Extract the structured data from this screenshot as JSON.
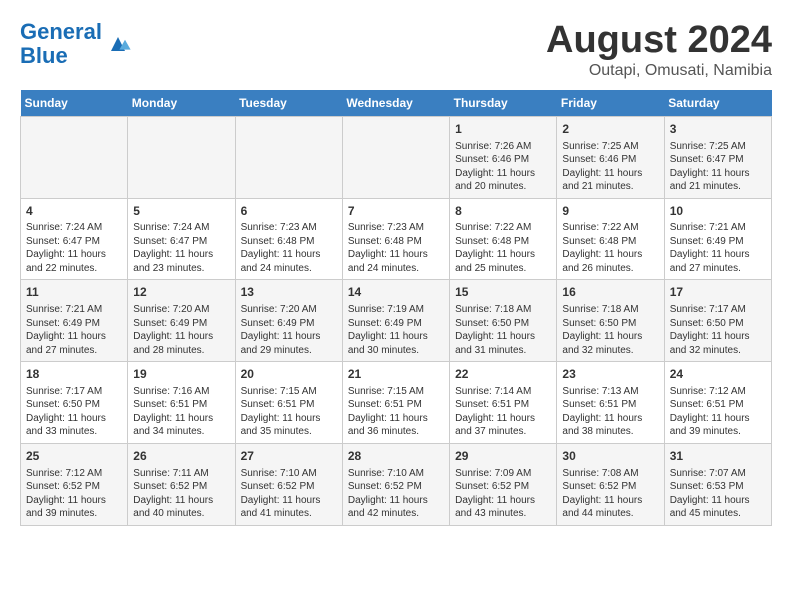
{
  "header": {
    "logo_line1": "General",
    "logo_line2": "Blue",
    "title": "August 2024",
    "subtitle": "Outapi, Omusati, Namibia"
  },
  "days_of_week": [
    "Sunday",
    "Monday",
    "Tuesday",
    "Wednesday",
    "Thursday",
    "Friday",
    "Saturday"
  ],
  "weeks": [
    [
      {
        "day": "",
        "info": ""
      },
      {
        "day": "",
        "info": ""
      },
      {
        "day": "",
        "info": ""
      },
      {
        "day": "",
        "info": ""
      },
      {
        "day": "1",
        "info": "Sunrise: 7:26 AM\nSunset: 6:46 PM\nDaylight: 11 hours and 20 minutes."
      },
      {
        "day": "2",
        "info": "Sunrise: 7:25 AM\nSunset: 6:46 PM\nDaylight: 11 hours and 21 minutes."
      },
      {
        "day": "3",
        "info": "Sunrise: 7:25 AM\nSunset: 6:47 PM\nDaylight: 11 hours and 21 minutes."
      }
    ],
    [
      {
        "day": "4",
        "info": "Sunrise: 7:24 AM\nSunset: 6:47 PM\nDaylight: 11 hours and 22 minutes."
      },
      {
        "day": "5",
        "info": "Sunrise: 7:24 AM\nSunset: 6:47 PM\nDaylight: 11 hours and 23 minutes."
      },
      {
        "day": "6",
        "info": "Sunrise: 7:23 AM\nSunset: 6:48 PM\nDaylight: 11 hours and 24 minutes."
      },
      {
        "day": "7",
        "info": "Sunrise: 7:23 AM\nSunset: 6:48 PM\nDaylight: 11 hours and 24 minutes."
      },
      {
        "day": "8",
        "info": "Sunrise: 7:22 AM\nSunset: 6:48 PM\nDaylight: 11 hours and 25 minutes."
      },
      {
        "day": "9",
        "info": "Sunrise: 7:22 AM\nSunset: 6:48 PM\nDaylight: 11 hours and 26 minutes."
      },
      {
        "day": "10",
        "info": "Sunrise: 7:21 AM\nSunset: 6:49 PM\nDaylight: 11 hours and 27 minutes."
      }
    ],
    [
      {
        "day": "11",
        "info": "Sunrise: 7:21 AM\nSunset: 6:49 PM\nDaylight: 11 hours and 27 minutes."
      },
      {
        "day": "12",
        "info": "Sunrise: 7:20 AM\nSunset: 6:49 PM\nDaylight: 11 hours and 28 minutes."
      },
      {
        "day": "13",
        "info": "Sunrise: 7:20 AM\nSunset: 6:49 PM\nDaylight: 11 hours and 29 minutes."
      },
      {
        "day": "14",
        "info": "Sunrise: 7:19 AM\nSunset: 6:49 PM\nDaylight: 11 hours and 30 minutes."
      },
      {
        "day": "15",
        "info": "Sunrise: 7:18 AM\nSunset: 6:50 PM\nDaylight: 11 hours and 31 minutes."
      },
      {
        "day": "16",
        "info": "Sunrise: 7:18 AM\nSunset: 6:50 PM\nDaylight: 11 hours and 32 minutes."
      },
      {
        "day": "17",
        "info": "Sunrise: 7:17 AM\nSunset: 6:50 PM\nDaylight: 11 hours and 32 minutes."
      }
    ],
    [
      {
        "day": "18",
        "info": "Sunrise: 7:17 AM\nSunset: 6:50 PM\nDaylight: 11 hours and 33 minutes."
      },
      {
        "day": "19",
        "info": "Sunrise: 7:16 AM\nSunset: 6:51 PM\nDaylight: 11 hours and 34 minutes."
      },
      {
        "day": "20",
        "info": "Sunrise: 7:15 AM\nSunset: 6:51 PM\nDaylight: 11 hours and 35 minutes."
      },
      {
        "day": "21",
        "info": "Sunrise: 7:15 AM\nSunset: 6:51 PM\nDaylight: 11 hours and 36 minutes."
      },
      {
        "day": "22",
        "info": "Sunrise: 7:14 AM\nSunset: 6:51 PM\nDaylight: 11 hours and 37 minutes."
      },
      {
        "day": "23",
        "info": "Sunrise: 7:13 AM\nSunset: 6:51 PM\nDaylight: 11 hours and 38 minutes."
      },
      {
        "day": "24",
        "info": "Sunrise: 7:12 AM\nSunset: 6:51 PM\nDaylight: 11 hours and 39 minutes."
      }
    ],
    [
      {
        "day": "25",
        "info": "Sunrise: 7:12 AM\nSunset: 6:52 PM\nDaylight: 11 hours and 39 minutes."
      },
      {
        "day": "26",
        "info": "Sunrise: 7:11 AM\nSunset: 6:52 PM\nDaylight: 11 hours and 40 minutes."
      },
      {
        "day": "27",
        "info": "Sunrise: 7:10 AM\nSunset: 6:52 PM\nDaylight: 11 hours and 41 minutes."
      },
      {
        "day": "28",
        "info": "Sunrise: 7:10 AM\nSunset: 6:52 PM\nDaylight: 11 hours and 42 minutes."
      },
      {
        "day": "29",
        "info": "Sunrise: 7:09 AM\nSunset: 6:52 PM\nDaylight: 11 hours and 43 minutes."
      },
      {
        "day": "30",
        "info": "Sunrise: 7:08 AM\nSunset: 6:52 PM\nDaylight: 11 hours and 44 minutes."
      },
      {
        "day": "31",
        "info": "Sunrise: 7:07 AM\nSunset: 6:53 PM\nDaylight: 11 hours and 45 minutes."
      }
    ]
  ]
}
